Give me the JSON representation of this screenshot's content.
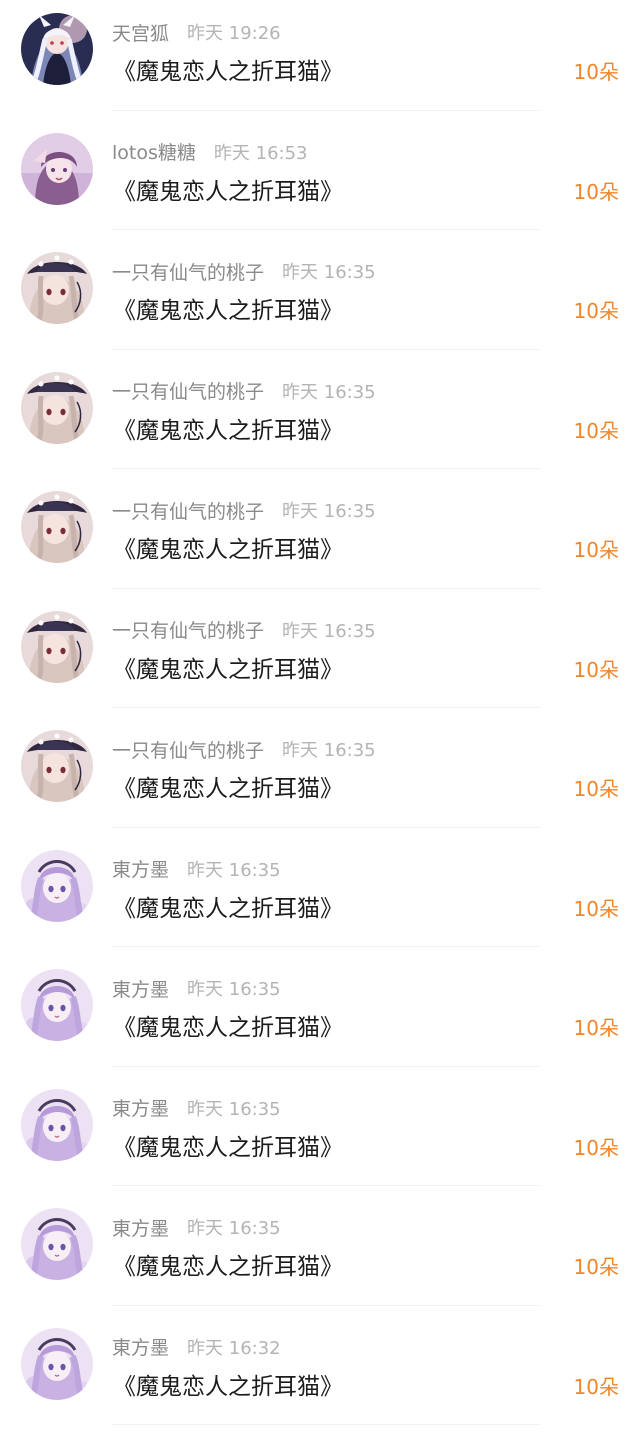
{
  "gift_list": {
    "items": [
      {
        "name": "天宫狐",
        "time": "昨天 19:26",
        "gift": "《魔鬼恋人之折耳猫》",
        "amount": "10朵",
        "avatar": "fox-girl-avatar"
      },
      {
        "name": "lotos糖糖",
        "time": "昨天 16:53",
        "gift": "《魔鬼恋人之折耳猫》",
        "amount": "10朵",
        "avatar": "purple-girl-avatar"
      },
      {
        "name": "一只有仙气的桃子",
        "time": "昨天 16:35",
        "gift": "《魔鬼恋人之折耳猫》",
        "amount": "10朵",
        "avatar": "dark-hat-girl-avatar"
      },
      {
        "name": "一只有仙气的桃子",
        "time": "昨天 16:35",
        "gift": "《魔鬼恋人之折耳猫》",
        "amount": "10朵",
        "avatar": "dark-hat-girl-avatar"
      },
      {
        "name": "一只有仙气的桃子",
        "time": "昨天 16:35",
        "gift": "《魔鬼恋人之折耳猫》",
        "amount": "10朵",
        "avatar": "dark-hat-girl-avatar"
      },
      {
        "name": "一只有仙气的桃子",
        "time": "昨天 16:35",
        "gift": "《魔鬼恋人之折耳猫》",
        "amount": "10朵",
        "avatar": "dark-hat-girl-avatar"
      },
      {
        "name": "一只有仙气的桃子",
        "time": "昨天 16:35",
        "gift": "《魔鬼恋人之折耳猫》",
        "amount": "10朵",
        "avatar": "dark-hat-girl-avatar"
      },
      {
        "name": "東方墨",
        "time": "昨天 16:35",
        "gift": "《魔鬼恋人之折耳猫》",
        "amount": "10朵",
        "avatar": "lavender-girl-avatar"
      },
      {
        "name": "東方墨",
        "time": "昨天 16:35",
        "gift": "《魔鬼恋人之折耳猫》",
        "amount": "10朵",
        "avatar": "lavender-girl-avatar"
      },
      {
        "name": "東方墨",
        "time": "昨天 16:35",
        "gift": "《魔鬼恋人之折耳猫》",
        "amount": "10朵",
        "avatar": "lavender-girl-avatar"
      },
      {
        "name": "東方墨",
        "time": "昨天 16:35",
        "gift": "《魔鬼恋人之折耳猫》",
        "amount": "10朵",
        "avatar": "lavender-girl-avatar"
      },
      {
        "name": "東方墨",
        "time": "昨天 16:32",
        "gift": "《魔鬼恋人之折耳猫》",
        "amount": "10朵",
        "avatar": "lavender-girl-avatar"
      }
    ]
  },
  "colors": {
    "amount": "#f0862c",
    "name": "#8a8a8a",
    "time": "#b4b4b4",
    "gift": "#1c1c1c",
    "divider": "#f1f1f1"
  }
}
